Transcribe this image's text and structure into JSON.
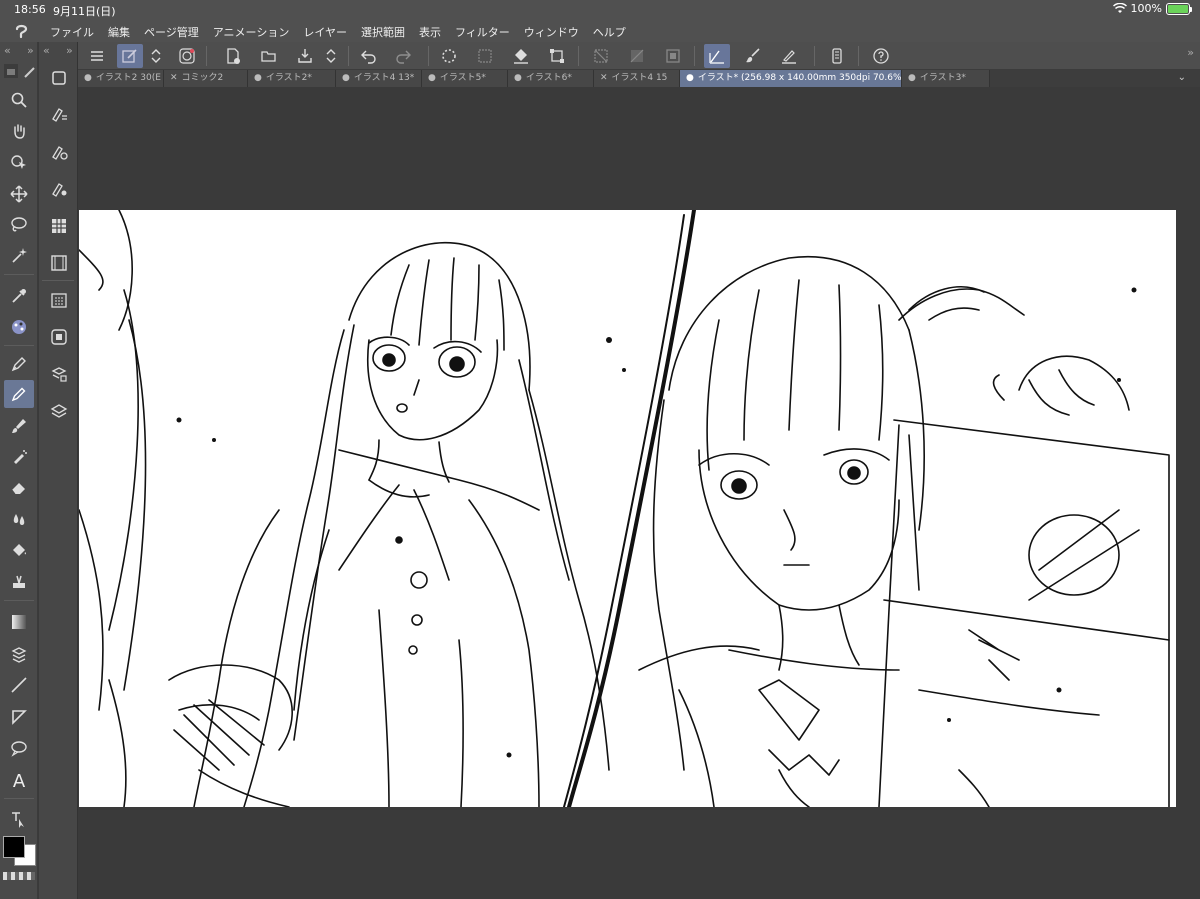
{
  "status": {
    "time": "18:56",
    "date": "9月11日(日)",
    "battery": "100%"
  },
  "menu": {
    "items": [
      "ファイル",
      "編集",
      "ページ管理",
      "アニメーション",
      "レイヤー",
      "選択範囲",
      "表示",
      "フィルター",
      "ウィンドウ",
      "ヘルプ"
    ]
  },
  "tabs": [
    {
      "marker": "●",
      "label": "イラスト2 30(E"
    },
    {
      "marker": "✕",
      "label": "コミック2"
    },
    {
      "marker": "●",
      "label": "イラスト2*"
    },
    {
      "marker": "●",
      "label": "イラスト4 13*"
    },
    {
      "marker": "●",
      "label": "イラスト5*"
    },
    {
      "marker": "●",
      "label": "イラスト6*"
    },
    {
      "marker": "✕",
      "label": "イラスト4 15"
    },
    {
      "marker": "●",
      "label": "イラスト* (256.98 x 140.00mm 350dpi 70.6%)"
    },
    {
      "marker": "●",
      "label": "イラスト3*"
    }
  ],
  "colors": {
    "main_color": "#000000",
    "sub_color": "#ffffff",
    "accent": "#687796"
  },
  "text_tool_glyph": "A"
}
